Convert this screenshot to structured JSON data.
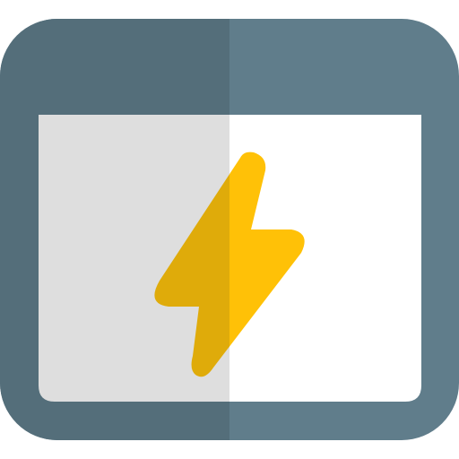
{
  "icon": {
    "name": "browser-window-lightning-icon",
    "colors": {
      "frame": "#607d8b",
      "frame_shadow": "#546e7a",
      "content": "#ffffff",
      "content_shadow": "#dedede",
      "bolt": "#ffc107",
      "bolt_shadow": "#dfab0a"
    }
  }
}
